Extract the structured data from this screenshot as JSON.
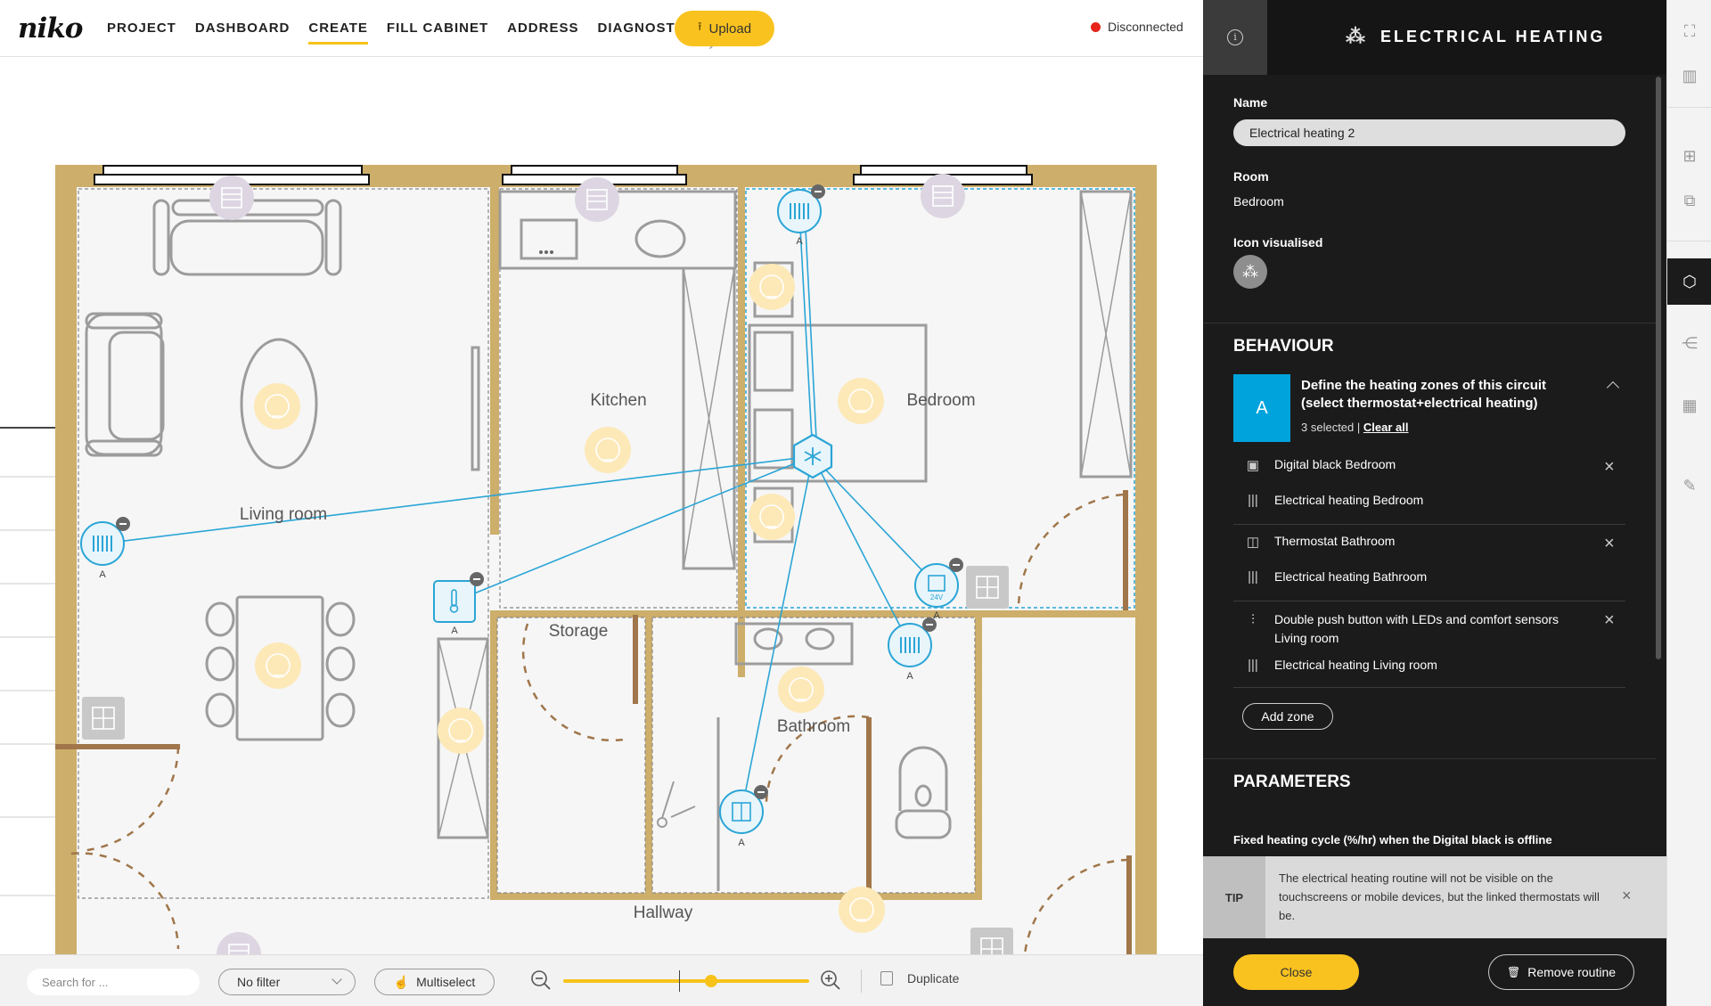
{
  "app": {
    "logo": "niko",
    "nav": [
      {
        "label": "PROJECT",
        "active": false
      },
      {
        "label": "DASHBOARD",
        "active": false
      },
      {
        "label": "CREATE",
        "active": true
      },
      {
        "label": "FILL CABINET",
        "active": false
      },
      {
        "label": "ADDRESS",
        "active": false
      },
      {
        "label": "DIAGNOSTICS",
        "active": false,
        "external": true
      }
    ],
    "upload_label": "Upload",
    "connection_status": "Disconnected",
    "colors": {
      "accent": "#f9c21f",
      "status_error": "#e8231c",
      "link_blue": "#2aa5d6",
      "wall": "#cdae6a",
      "panel_bg": "#1b1b1b"
    }
  },
  "floorplan": {
    "rooms": [
      "Living room",
      "Kitchen",
      "Bedroom",
      "Storage",
      "Bathroom",
      "Hallway"
    ],
    "zone_label": "A"
  },
  "toolbar": {
    "search_placeholder": "Search for ...",
    "filter_value": "No filter",
    "multiselect_label": "Multiselect",
    "zoom_level": 0.6,
    "duplicate_label": "Duplicate"
  },
  "panel": {
    "title": "ELECTRICAL HEATING",
    "name_label": "Name",
    "name_value": "Electrical heating 2",
    "room_label": "Room",
    "room_value": "Bedroom",
    "icon_label": "Icon visualised",
    "behaviour_title": "BEHAVIOUR",
    "zone_badge": "A",
    "zone_title": "Define the heating zones of this circuit (select thermostat+electrical heating)",
    "zone_selected": "3 selected |",
    "zone_clear": "Clear all",
    "zones": [
      {
        "thermostat": "Digital black Bedroom",
        "heating": "Electrical heating Bedroom"
      },
      {
        "thermostat": "Thermostat Bathroom",
        "heating": "Electrical heating Bathroom"
      },
      {
        "thermostat": "Double push button with LEDs and comfort sensors Living room",
        "heating": "Electrical heating Living room"
      }
    ],
    "add_zone_label": "Add zone",
    "parameters_title": "PARAMETERS",
    "fixed_cycle_label": "Fixed heating cycle (%/hr) when the Digital black is offline",
    "tip_label": "TIP",
    "tip_text": "The electrical heating routine will not be visible on the touchscreens or mobile devices, but the linked thermostats will be.",
    "close_label": "Close",
    "remove_label": "Remove routine"
  }
}
